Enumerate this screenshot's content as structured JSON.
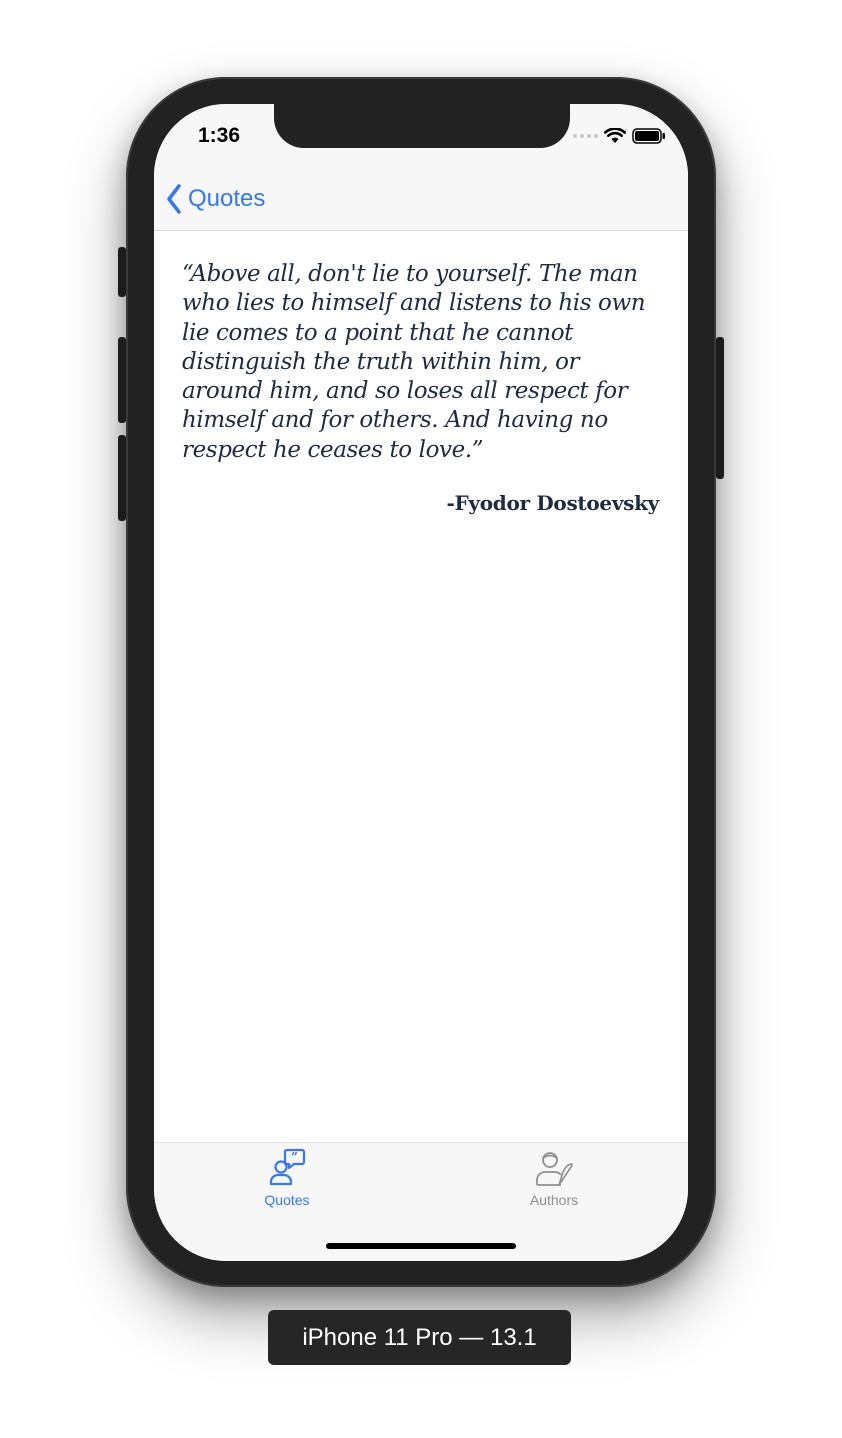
{
  "status_bar": {
    "time": "1:36"
  },
  "nav": {
    "back_label": "Quotes"
  },
  "quote": {
    "text": "“Above all, don't lie to yourself. The man who lies to himself and listens to his own lie comes to a point that he cannot distinguish the truth within him, or around him, and so loses all respect for himself and for others. And having no respect he ceases to love.”",
    "author": "-Fyodor Dostoevsky"
  },
  "tabbar": {
    "tabs": [
      {
        "label": "Quotes",
        "icon": "person-quote-icon",
        "active": true
      },
      {
        "label": "Authors",
        "icon": "author-quill-icon",
        "active": false
      }
    ]
  },
  "device_label": "iPhone 11 Pro — 13.1",
  "colors": {
    "accent": "#3478f6",
    "text": "#1f2b40",
    "inactive": "#8e8e93"
  }
}
